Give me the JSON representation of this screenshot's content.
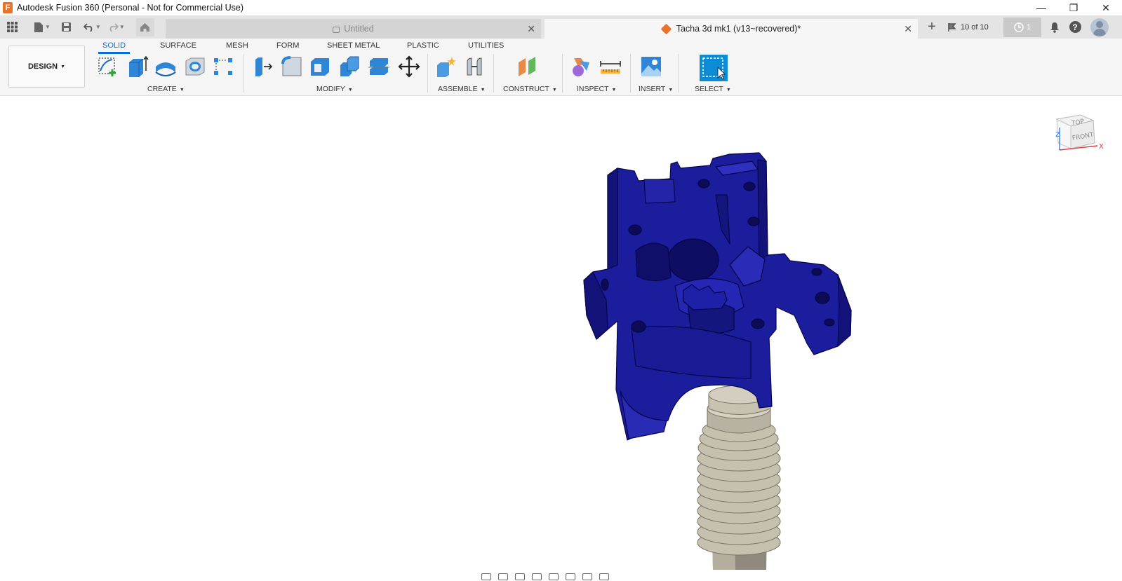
{
  "window": {
    "title": "Autodesk Fusion 360 (Personal - Not for Commercial Use)",
    "logo_letter": "F",
    "minimize": "—",
    "maximize": "❐",
    "close": "✕"
  },
  "tabs": [
    {
      "label": "Untitled",
      "active": false,
      "close": "✕"
    },
    {
      "label": "Tacha 3d mk1 (v13~recovered)*",
      "active": true,
      "close": "✕"
    }
  ],
  "tab_right": {
    "new_tab": "+",
    "version": "10 of 10",
    "jobs_count": "1",
    "help": "?"
  },
  "toolbar": {
    "workspace": "DESIGN",
    "tabs": [
      "SOLID",
      "SURFACE",
      "MESH",
      "FORM",
      "SHEET METAL",
      "PLASTIC",
      "UTILITIES"
    ],
    "active_tab": "SOLID",
    "panels": [
      "CREATE",
      "MODIFY",
      "ASSEMBLE",
      "CONSTRUCT",
      "INSPECT",
      "INSERT",
      "SELECT"
    ]
  },
  "viewcube": {
    "top": "TOP",
    "front": "FRONT",
    "x_axis": "X",
    "z_axis": "Z"
  },
  "colors": {
    "accent": "#0a6fd8",
    "model_blue": "#1c1d9c",
    "model_dark": "#0f0f6a",
    "heatsink": "#bdb7a6",
    "brand_orange": "#e8732a"
  }
}
